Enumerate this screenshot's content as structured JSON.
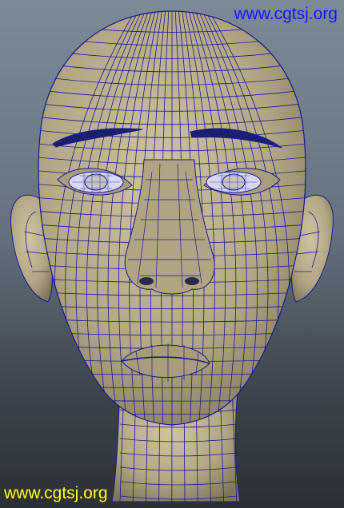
{
  "watermark": {
    "top": "www.cgtsj.org",
    "bottom": "www.cgtsj.org"
  },
  "colors": {
    "skin": "#b5a98a",
    "wire": "#161a8c",
    "background_top": "#7c8a98",
    "background_bottom": "#2b3036",
    "watermark_top": "#1414ff",
    "watermark_bottom": "#ffff00"
  },
  "scene": {
    "subject": "head-mesh",
    "shading": "wireframe-on-shaded"
  }
}
